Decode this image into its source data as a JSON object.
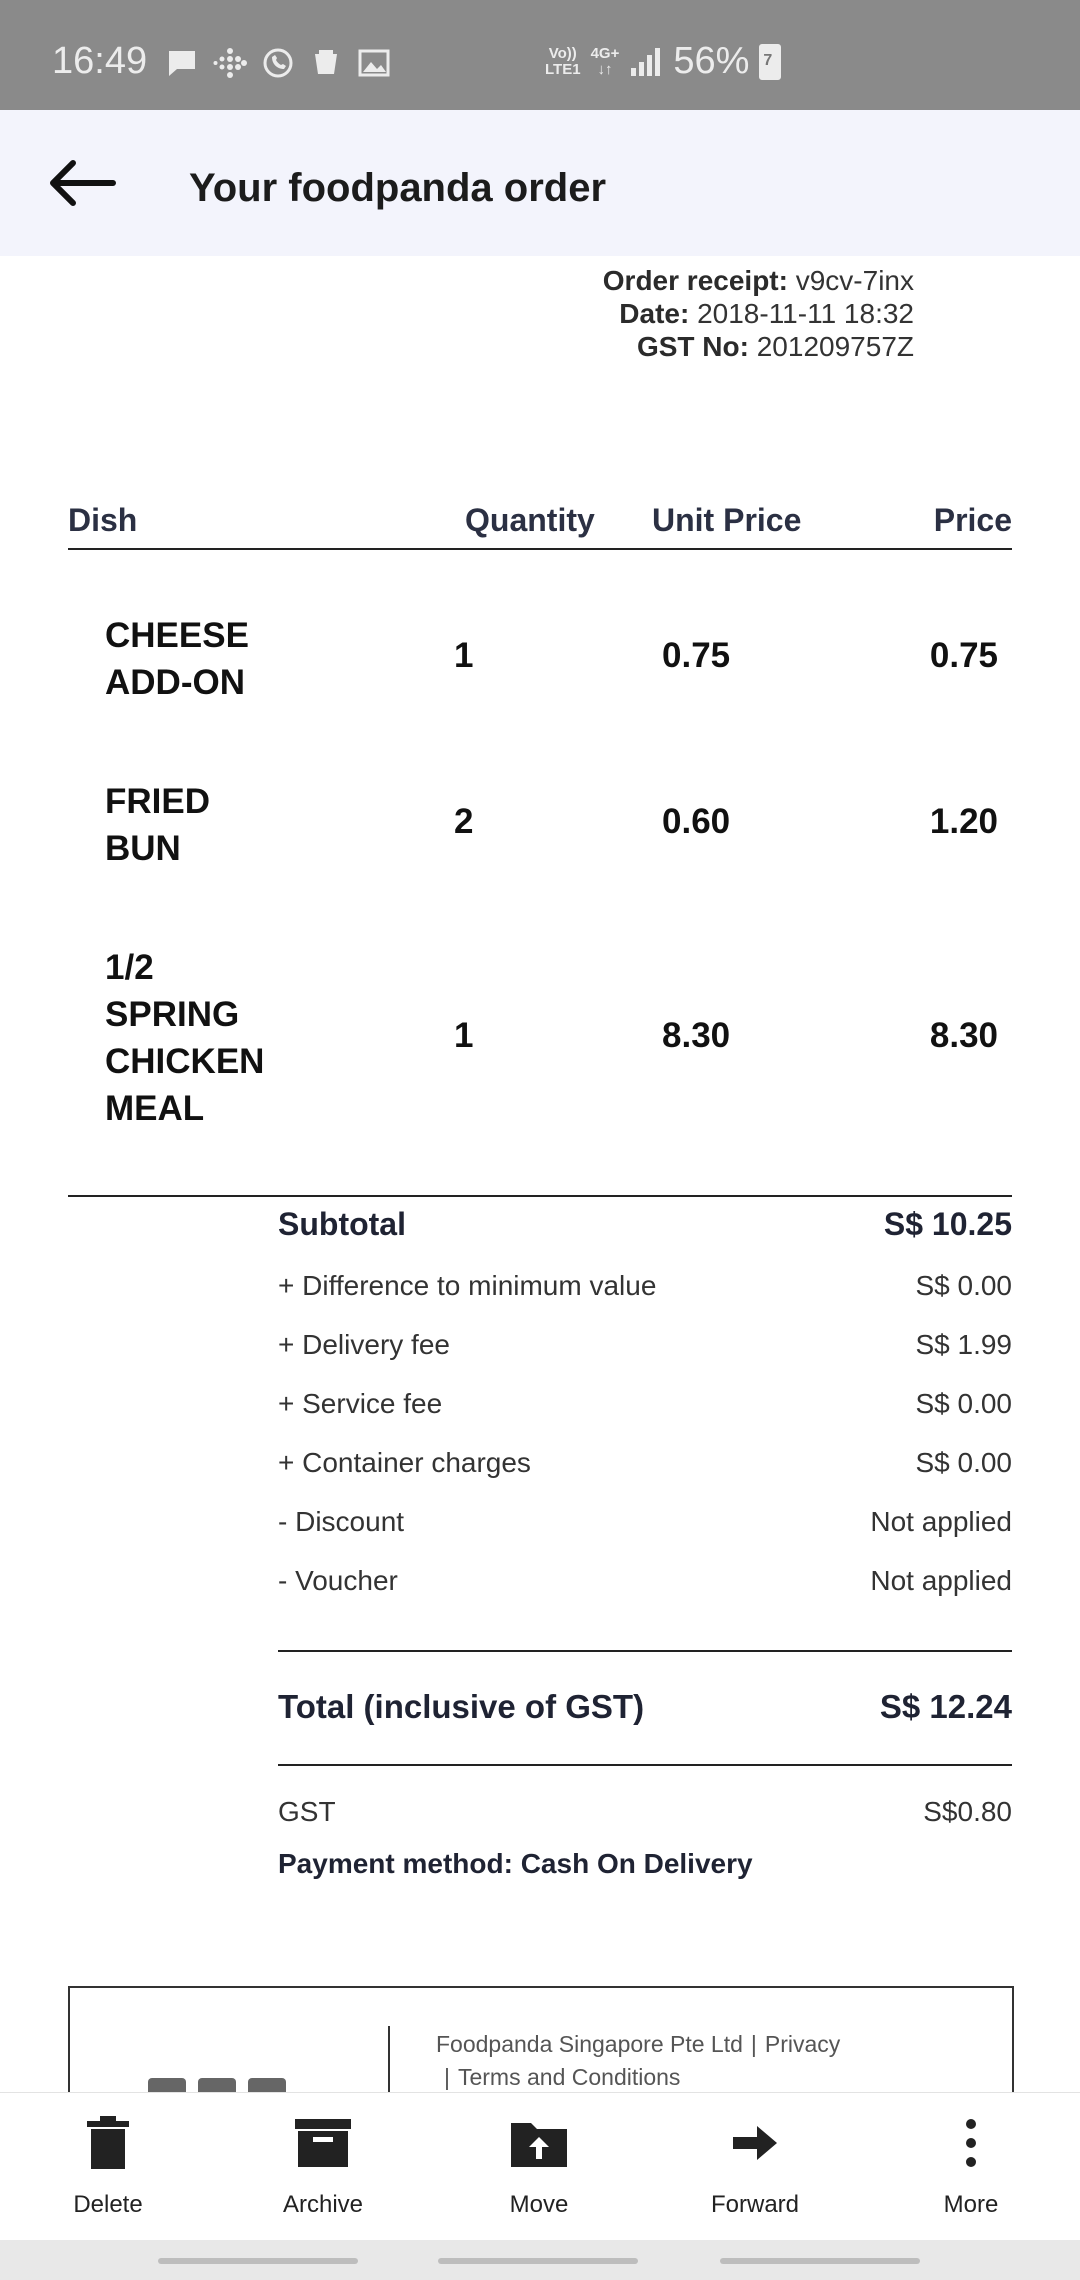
{
  "status_bar": {
    "time": "16:49",
    "network_top": "Vo))",
    "network_bottom": "LTE1",
    "network_type": "4G+",
    "battery_percent": "56%",
    "battery_glyph": "7"
  },
  "header": {
    "title": "Your foodpanda order"
  },
  "receipt": {
    "order_label": "Order receipt:",
    "order_value": "v9cv-7inx",
    "date_label": "Date:",
    "date_value": "2018-11-11 18:32",
    "gst_label": "GST No:",
    "gst_value": "201209757Z"
  },
  "table": {
    "headers": [
      "Dish",
      "Quantity",
      "Unit Price",
      "Price"
    ],
    "rows": [
      {
        "dish_line1": "CHEESE",
        "dish_line2": "ADD-ON",
        "dish_line3": "",
        "dish_line4": "",
        "qty": "1",
        "unit": "0.75",
        "price": "0.75"
      },
      {
        "dish_line1": "FRIED",
        "dish_line2": "BUN",
        "dish_line3": "",
        "dish_line4": "",
        "qty": "2",
        "unit": "0.60",
        "price": "1.20"
      },
      {
        "dish_line1": "1/2",
        "dish_line2": "SPRING",
        "dish_line3": "CHICKEN",
        "dish_line4": "MEAL",
        "qty": "1",
        "unit": "8.30",
        "price": "8.30"
      }
    ]
  },
  "summary": {
    "subtotal_label": "Subtotal",
    "subtotal_value": "S$ 10.25",
    "lines": [
      {
        "label": "+ Difference to minimum value",
        "value": "S$ 0.00"
      },
      {
        "label": "+ Delivery fee",
        "value": "S$ 1.99"
      },
      {
        "label": "+ Service fee",
        "value": "S$ 0.00"
      },
      {
        "label": "+ Container charges",
        "value": "S$ 0.00"
      },
      {
        "label": "- Discount",
        "value": "Not applied"
      },
      {
        "label": "- Voucher",
        "value": "Not applied"
      }
    ],
    "total_label": "Total (inclusive of GST)",
    "total_value": "S$ 12.24",
    "gst_label": "GST",
    "gst_value": "S$0.80",
    "payment": "Payment method: Cash On Delivery"
  },
  "footer": {
    "company": "Foodpanda Singapore Pte Ltd",
    "separator": "|",
    "privacy": "Privacy",
    "terms": "Terms and Conditions"
  },
  "actions": {
    "delete": "Delete",
    "archive": "Archive",
    "move": "Move",
    "forward": "Forward",
    "more": "More"
  }
}
